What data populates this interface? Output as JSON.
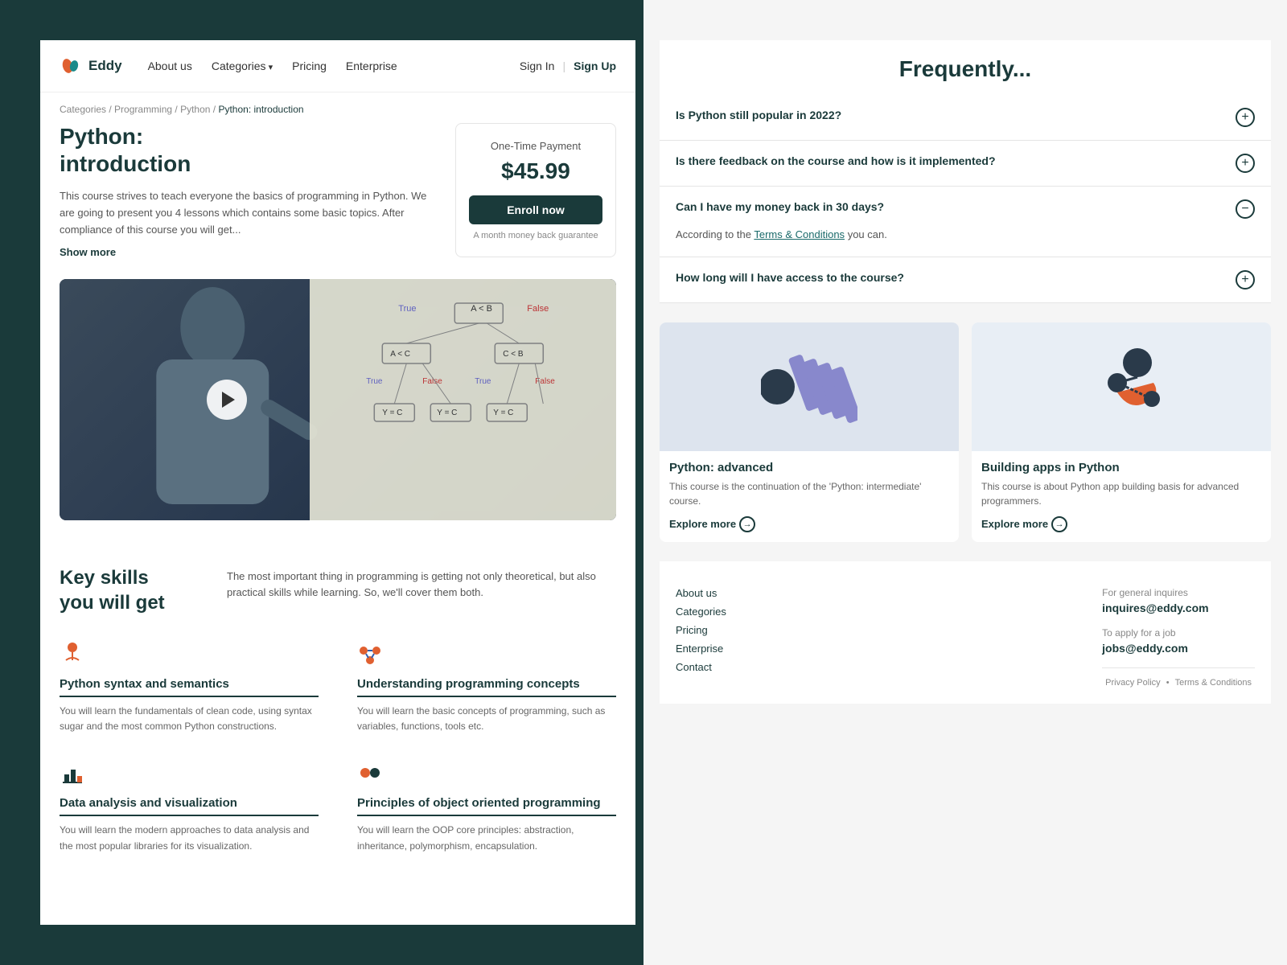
{
  "brand": {
    "name": "Eddy",
    "logo_alt": "Eddy logo"
  },
  "navbar": {
    "links": [
      {
        "label": "About us",
        "has_arrow": false
      },
      {
        "label": "Categories",
        "has_arrow": true
      },
      {
        "label": "Pricing",
        "has_arrow": false
      },
      {
        "label": "Enterprise",
        "has_arrow": false
      }
    ],
    "signin": "Sign In",
    "signup": "Sign Up",
    "divider": "|"
  },
  "breadcrumb": {
    "items": [
      "Categories",
      "Programming",
      "Python"
    ],
    "current": "Python: introduction"
  },
  "course": {
    "title_line1": "Python:",
    "title_line2": "introduction",
    "description": "This course strives to teach everyone the basics of programming in Python. We are going to present you 4 lessons which contains some basic topics. After compliance of this course you will get...",
    "show_more": "Show more"
  },
  "payment": {
    "type": "One-Time Payment",
    "price": "$45.99",
    "enroll_label": "Enroll now",
    "guarantee": "A month money back guarantee"
  },
  "faq": {
    "heading": "Frequently",
    "items": [
      {
        "question": "Is Python still popular in 2022?",
        "expanded": false,
        "toggle": "+"
      },
      {
        "question": "Is there feedback on the course and how is it implemented?",
        "expanded": false,
        "toggle": "+"
      },
      {
        "question": "Can I have my money back in 30 days?",
        "expanded": true,
        "toggle": "−",
        "answer": "According to the",
        "answer_link": "Terms & Conditions",
        "answer_end": " you can."
      },
      {
        "question": "How long will I have access to the course?",
        "expanded": false,
        "toggle": "+"
      }
    ]
  },
  "related_courses": [
    {
      "title": "Python: advanced",
      "description": "This course is the continuation of the 'Python: intermediate' course.",
      "explore": "Explore more"
    },
    {
      "title": "Building apps in Python",
      "description": "This course is about Python app building basis for advanced programmers.",
      "explore": "Explore more"
    }
  ],
  "key_skills": {
    "heading_line1": "Key skills",
    "heading_line2": "you will get",
    "description": "The most important thing in programming is getting not only theoretical, but also practical skills while learning. So, we'll cover them both.",
    "items": [
      {
        "name": "Python syntax and semantics",
        "description": "You will learn the fundamentals of clean code, using syntax sugar and the most common Python constructions.",
        "icon": "code-icon"
      },
      {
        "name": "Understanding programming concepts",
        "description": "You will learn the basic concepts of programming, such as variables, functions, tools etc.",
        "icon": "concept-icon"
      },
      {
        "name": "Data analysis and visualization",
        "description": "You will learn the modern approaches to data analysis and the most popular libraries for its visualization.",
        "icon": "chart-icon"
      },
      {
        "name": "Principles of object oriented programming",
        "description": "You will learn the OOP core principles: abstraction, inheritance, polymorphism, encapsulation.",
        "icon": "oop-icon"
      }
    ]
  },
  "footer": {
    "links": [
      "About us",
      "Categories",
      "Pricing",
      "Enterprise",
      "Contact"
    ],
    "contact_general_label": "For general inquires",
    "contact_general_email": "inquires@eddy.com",
    "contact_job_label": "To apply for a job",
    "contact_job_email": "jobs@eddy.com",
    "privacy": "Privacy Policy",
    "terms": "Terms & Conditions",
    "separator": "•"
  }
}
